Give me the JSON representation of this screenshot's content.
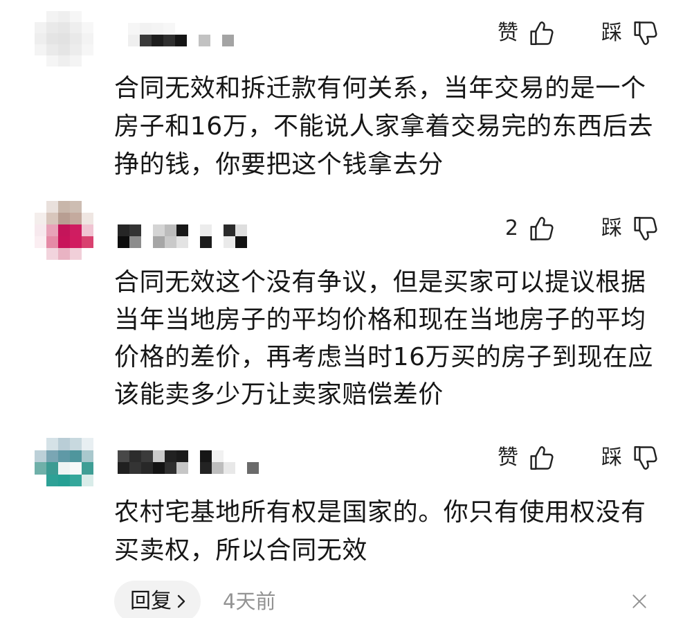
{
  "colors": {
    "background": "#ffffff",
    "text": "#161616",
    "meta": "#939393",
    "icon": "#222222",
    "pill_bg": "#f2f2f2"
  },
  "icons": {
    "like": "thumbs-up-icon",
    "dislike": "thumbs-down-icon",
    "reply_chevron": "chevron-right-icon",
    "close": "close-icon"
  },
  "comments": [
    {
      "like_label": "赞",
      "dislike_label": "踩",
      "lines": [
        "合同无效和拆迁款有何关系，当年交易的是一个",
        "房子和16万，不能说人家拿着交易完的东西后去",
        "挣的钱，你要把这个钱拿去分"
      ]
    },
    {
      "like_label": "2",
      "dislike_label": "踩",
      "lines": [
        "合同无效这个没有争议，但是买家可以提议根据",
        "当年当地房子的平均价格和现在当地房子的平均",
        "价格的差价，再考虑当时16万买的房子到现在应",
        "该能卖多少万让卖家赔偿差价"
      ]
    },
    {
      "like_label": "赞",
      "dislike_label": "踩",
      "lines": [
        "农村宅基地所有权是国家的。你只有使用权没有",
        "买卖权，所以合同无效"
      ]
    }
  ],
  "footer": {
    "reply_label": "回复",
    "time_ago": "4天前"
  }
}
